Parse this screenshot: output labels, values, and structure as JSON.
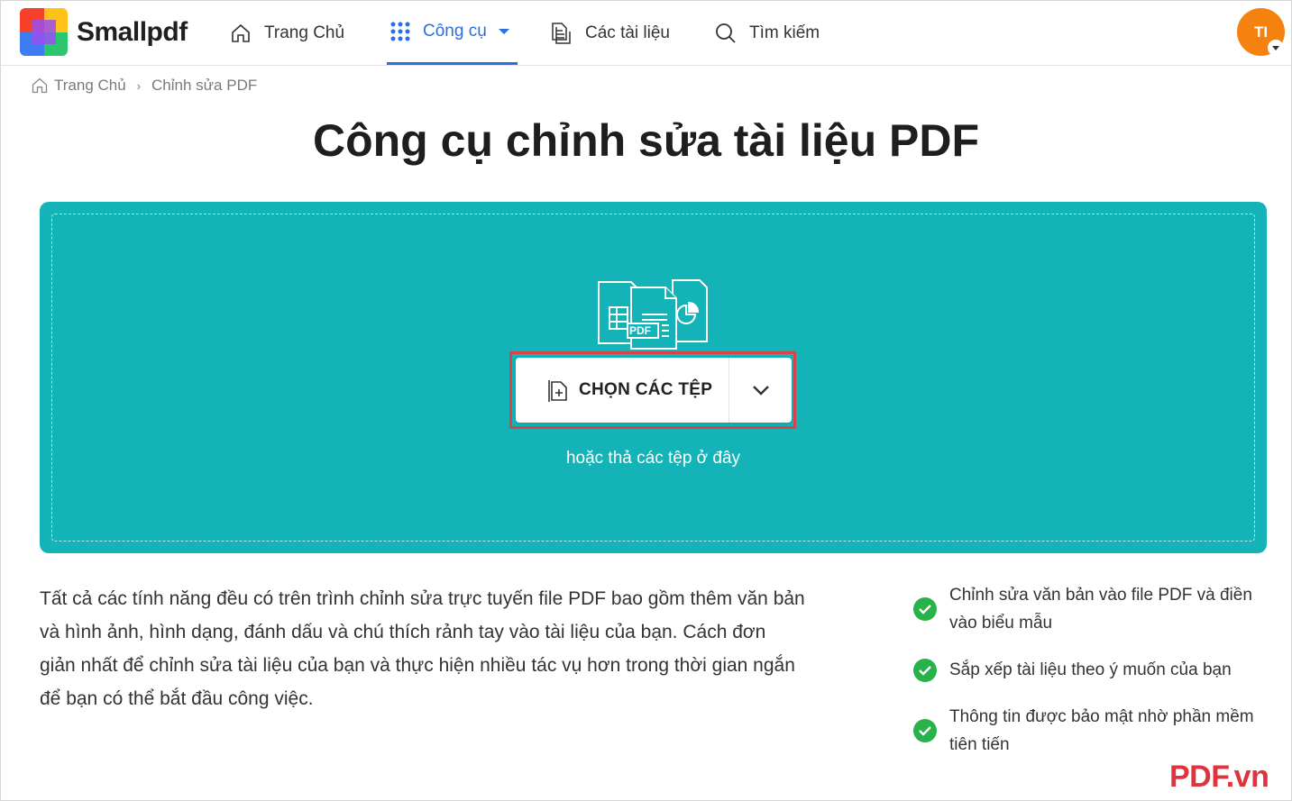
{
  "header": {
    "logo_text": "Smallpdf",
    "nav": [
      {
        "label": "Trang Chủ",
        "icon": "home-icon"
      },
      {
        "label": "Công cụ",
        "icon": "grid-icon",
        "active": true
      },
      {
        "label": "Các tài liệu",
        "icon": "documents-icon"
      },
      {
        "label": "Tìm kiếm",
        "icon": "search-icon"
      }
    ],
    "avatar_initials": "TI"
  },
  "breadcrumb": {
    "home": "Trang Chủ",
    "separator": "›",
    "current": "Chỉnh sửa PDF"
  },
  "page_title": "Công cụ chỉnh sửa tài liệu PDF",
  "upload": {
    "pdf_badge": "PDF",
    "choose_label": "CHỌN CÁC TỆP",
    "drop_hint": "hoặc thả các tệp ở đây"
  },
  "description": "Tất cả các tính năng đều có trên trình chỉnh sửa trực tuyến file PDF bao gồm thêm văn bản và hình ảnh, hình dạng, đánh dấu và chú thích rảnh tay vào tài liệu của bạn. Cách đơn giản nhất để chỉnh sửa tài liệu của bạn và thực hiện nhiều tác vụ hơn trong thời gian ngắn để bạn có thể bắt đầu công việc.",
  "features": [
    "Chỉnh sửa văn bản vào file PDF và điền vào biểu mẫu",
    "Sắp xếp tài liệu theo ý muốn của bạn",
    "Thông tin được bảo mật nhờ phần mềm tiên tiến"
  ],
  "watermark": "PDF.vn",
  "colors": {
    "accent_blue": "#2a6fe0",
    "teal": "#14b3b8",
    "highlight_red": "#d9434a",
    "avatar_orange": "#f5820f",
    "check_green": "#27b24a",
    "watermark_red": "#e0333d"
  }
}
